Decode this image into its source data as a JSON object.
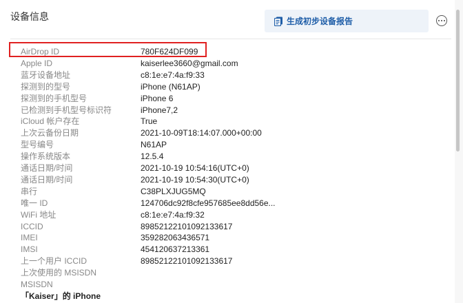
{
  "header": {
    "title": "设备信息",
    "report_button_label": "生成初步设备报告",
    "report_icon": "document-icon",
    "more_icon": "more-options-icon"
  },
  "colors": {
    "accent": "#1f5ea8",
    "highlight_border": "#e02020",
    "button_bg": "#eef3f9"
  },
  "rows": [
    {
      "key": "AirDrop ID",
      "value": "780F624DF099"
    },
    {
      "key": "Apple ID",
      "value": "kaiserlee3660@gmail.com"
    },
    {
      "key": "蓝牙设备地址",
      "value": "c8:1e:e7:4a:f9:33"
    },
    {
      "key": "探测到的型号",
      "value": "iPhone (N61AP)"
    },
    {
      "key": "探测到的手机型号",
      "value": "iPhone 6"
    },
    {
      "key": "已检测到手机型号标识符",
      "value": "iPhone7,2"
    },
    {
      "key": "iCloud 帐户存在",
      "value": "True"
    },
    {
      "key": "上次云备份日期",
      "value": "2021-10-09T18:14:07.000+00:00"
    },
    {
      "key": "型号编号",
      "value": "N61AP"
    },
    {
      "key": "操作系统版本",
      "value": "12.5.4"
    },
    {
      "key": "通话日期/时间",
      "value": "2021-10-19 10:54:16(UTC+0)"
    },
    {
      "key": "通话日期/时间",
      "value": "2021-10-19 10:54:30(UTC+0)"
    },
    {
      "key": "串行",
      "value": "C38PLXJUG5MQ"
    },
    {
      "key": "唯一 ID",
      "value": "124706dc92f8cfe957685ee8dd56e..."
    },
    {
      "key": "WiFi 地址",
      "value": "c8:1e:e7:4a:f9:32"
    },
    {
      "key": "ICCID",
      "value": "89852122101092133617"
    },
    {
      "key": "IMEI",
      "value": "359282063436571"
    },
    {
      "key": "IMSI",
      "value": "454120637213361"
    },
    {
      "key": "上一个用户 ICCID",
      "value": "89852122101092133617"
    },
    {
      "key": "上次使用的 MSISDN",
      "value": ""
    },
    {
      "key": "MSISDN",
      "value": ""
    },
    {
      "key": "「Kaiser」的 iPhone",
      "value": "",
      "bold": true
    }
  ]
}
